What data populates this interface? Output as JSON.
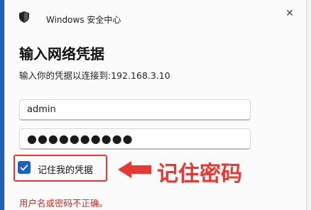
{
  "window": {
    "app_title": "Windows 安全中心"
  },
  "dialog": {
    "heading": "输入网络凭据",
    "subtitle": "输入你的凭据以连接到:192.168.3.10",
    "username_value": "admin",
    "password_value": "●●●●●●●●●●",
    "remember_label": "记住我的凭据",
    "remember_checked": true,
    "error_text": "用户名或密码不正确。"
  },
  "annotation": {
    "text": "记住密码",
    "color": "#e53935"
  },
  "colors": {
    "accent": "#1b5fc1",
    "error": "#c42b1c"
  }
}
